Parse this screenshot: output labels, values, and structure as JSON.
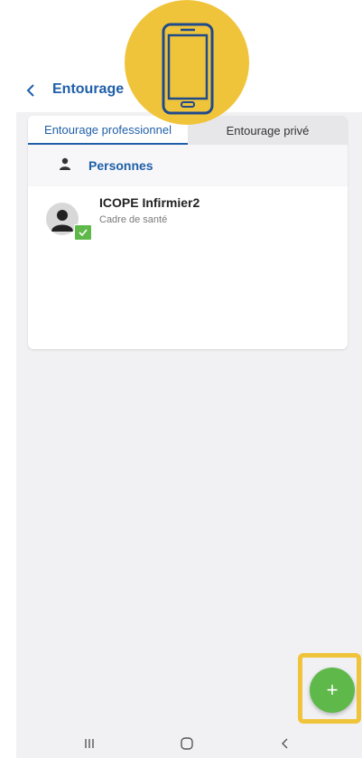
{
  "header": {
    "back_icon": "chevron-left-icon",
    "title": "Entourage"
  },
  "tabs": [
    {
      "label": "Entourage professionnel",
      "active": true
    },
    {
      "label": "Entourage privé",
      "active": false
    }
  ],
  "section": {
    "icon": "person-icon",
    "title": "Personnes"
  },
  "persons": [
    {
      "name": "ICOPE Infirmier2",
      "role": "Cadre de santé",
      "avatar_icon": "person-icon",
      "badge_icon": "check-icon"
    }
  ],
  "overlay_icon": "smartphone-icon",
  "fab": {
    "label": "+",
    "icon": "plus-icon"
  },
  "colors": {
    "primary": "#1f5fa8",
    "accent": "#5fb94a",
    "highlight": "#f0c43a",
    "background": "#f1f1f3"
  },
  "navbar": {
    "buttons": [
      "recent-apps-icon",
      "home-icon",
      "back-icon"
    ]
  }
}
